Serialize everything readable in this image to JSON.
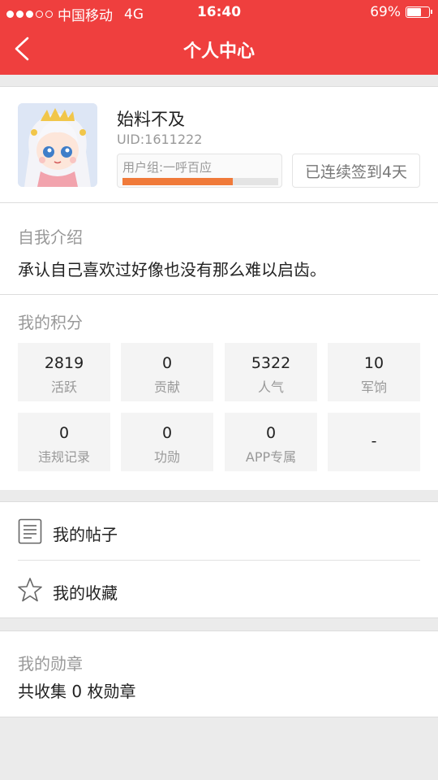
{
  "status_bar": {
    "carrier": "中国移动",
    "network": "4G",
    "time": "16:40",
    "battery_percent": "69%",
    "battery_level": 0.69,
    "signal_bars": 3
  },
  "header": {
    "title": "个人中心",
    "back_icon": "chevron-left-icon",
    "background_color": "#ef3f3e"
  },
  "profile": {
    "username": "始料不及",
    "uid": "UID:1611222",
    "group_label": "用户组:一呼百应",
    "group_progress": 0.71,
    "checkin_text": "已连续签到4天",
    "progress_color": "#f07a3a"
  },
  "intro": {
    "heading": "自我介绍",
    "text": "承认自己喜欢过好像也没有那么难以启齿。"
  },
  "points": {
    "heading": "我的积分",
    "items": [
      {
        "value": "2819",
        "label": "活跃"
      },
      {
        "value": "0",
        "label": "贡献"
      },
      {
        "value": "5322",
        "label": "人气"
      },
      {
        "value": "10",
        "label": "军饷"
      },
      {
        "value": "0",
        "label": "违规记录"
      },
      {
        "value": "0",
        "label": "功勋"
      },
      {
        "value": "0",
        "label": "APP专属"
      },
      {
        "value": "-",
        "label": ""
      }
    ]
  },
  "menu": {
    "items": [
      {
        "label": "我的帖子",
        "icon": "document-list-icon"
      },
      {
        "label": "我的收藏",
        "icon": "star-outline-icon"
      }
    ]
  },
  "medals": {
    "heading": "我的勋章",
    "summary": "共收集 0 枚勋章"
  }
}
